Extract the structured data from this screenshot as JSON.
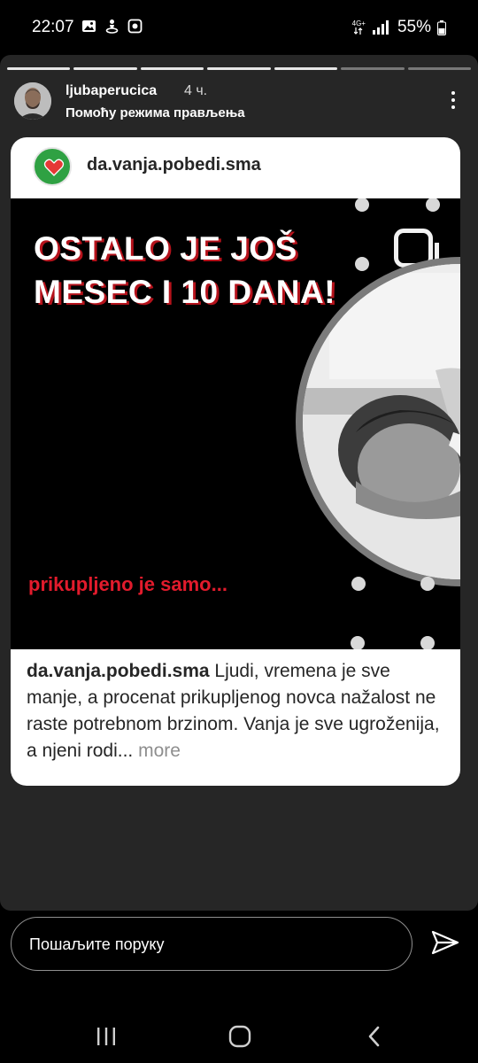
{
  "status_bar": {
    "time": "22:07",
    "network": "4G+",
    "battery": "55%",
    "left_icons": [
      "gallery-icon",
      "gps-person-icon",
      "app-icon"
    ]
  },
  "story": {
    "progress_segments": 7,
    "progress_completed": 5,
    "username": "ljubaperucica",
    "time_ago": "4 ч.",
    "subtitle": "Помоћу режима прављења"
  },
  "post": {
    "username": "da.vanja.pobedi.sma",
    "image": {
      "headline": [
        "OSTALO JE JOŠ",
        "MESEC I 10 DANA!"
      ],
      "subtext": "prikupljeno je samo..."
    },
    "caption": {
      "user": "da.vanja.pobedi.sma",
      "text": " Ljudi, vremena je sve manje, a procenat prikupljenog novca nažalost ne raste potrebnom brzinom. Vanja je sve ugroženija, a njeni rodi...",
      "more": " more"
    }
  },
  "reply": {
    "placeholder": "Пошаљите поруку"
  },
  "colors": {
    "story_bg": "#262626",
    "headline_shadow": "#b5121b",
    "subtext_red": "#e21b2c",
    "post_avatar_green": "#2fa143"
  }
}
